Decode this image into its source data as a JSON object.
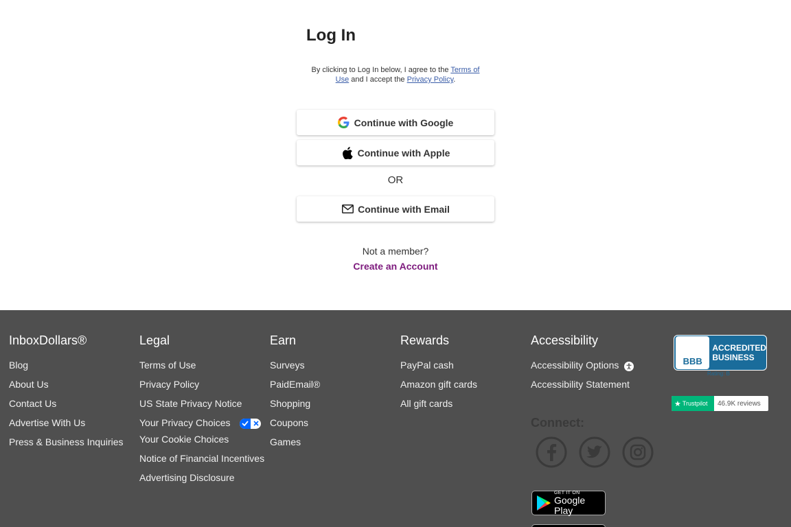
{
  "login": {
    "title": "Log In",
    "terms_prefix": "By clicking to Log In below, I agree to the ",
    "terms_link": "Terms of Use",
    "terms_mid": " and I accept the ",
    "privacy_link": "Privacy Policy",
    "terms_suffix": ".",
    "google_label": "Continue with Google",
    "apple_label": "Continue with Apple",
    "or_label": "OR",
    "email_label": "Continue with Email",
    "not_member": "Not a member?",
    "create_account": "Create an Account",
    "create_color": "#7d1a7d"
  },
  "footer": {
    "background": "#4f4f4f",
    "columns": {
      "brand": {
        "title": "InboxDollars®",
        "links": [
          "Blog",
          "About Us",
          "Contact Us",
          "Advertise With Us",
          "Press & Business Inquiries"
        ]
      },
      "legal": {
        "title": "Legal",
        "links": [
          "Terms of Use",
          "Privacy Policy",
          "US State Privacy Notice",
          "Your Privacy Choices",
          "Your Cookie Choices",
          "Notice of Financial Incentives",
          "Advertising Disclosure"
        ]
      },
      "earn": {
        "title": "Earn",
        "links": [
          "Surveys",
          "PaidEmail®",
          "Shopping",
          "Coupons",
          "Games"
        ]
      },
      "rewards": {
        "title": "Rewards",
        "links": [
          "PayPal cash",
          "Amazon gift cards",
          "All gift cards"
        ]
      },
      "accessibility": {
        "title": "Accessibility",
        "links": [
          "Accessibility Options",
          "Accessibility Statement"
        ]
      }
    },
    "connect_label": "Connect:",
    "social_icons": [
      "facebook-icon",
      "twitter-icon",
      "instagram-icon"
    ],
    "google_play": {
      "line1": "GET IT ON",
      "line2": "Google Play"
    },
    "bbb": {
      "logo_text": "BBB",
      "line1": "ACCREDITED",
      "line2": "BUSINESS",
      "rating": "Rating: B"
    },
    "trustpilot": {
      "brand": "Trustpilot",
      "reviews": "46.9K reviews",
      "color": "#00b67a"
    }
  }
}
